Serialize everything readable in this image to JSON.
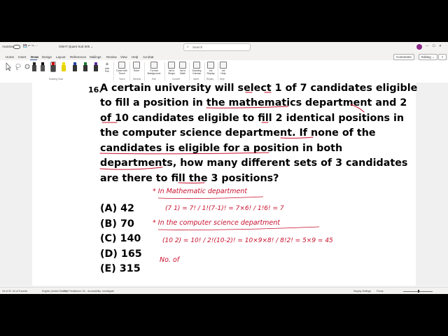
{
  "titlebar": {
    "autosave": "AutoSave",
    "doc_title": "GMAT Quant Sub 505 ⌄",
    "search_placeholder": "Search"
  },
  "tabs": [
    "Home",
    "Insert",
    "Draw",
    "Design",
    "Layout",
    "References",
    "Mailings",
    "Review",
    "View",
    "Help",
    "Acrobat"
  ],
  "active_tab": "Draw",
  "tab_actions": {
    "comments": "Comments",
    "editing": "Editing ⌄"
  },
  "ribbon": {
    "buttons": [
      {
        "label": "Draw with Touch"
      },
      {
        "label": "Ruler"
      },
      {
        "label": "Format Background"
      },
      {
        "label": "Ink to Shape"
      },
      {
        "label": "Ink to Math"
      },
      {
        "label": "Drawing Canvas"
      },
      {
        "label": "Ink Replay"
      },
      {
        "label": "Ink Help"
      }
    ],
    "add_pen_label": "Add Pen",
    "groups": {
      "drawing_tools": "Drawing Tools",
      "touch": "Touch",
      "stencils": "Stencils",
      "edit": "Edit",
      "convert": "Convert",
      "insert": "Insert",
      "replay": "Replay",
      "help": "Help"
    },
    "pen_colors": [
      "#d40000",
      "#f2e000",
      "#1a7a30",
      "#1f3f9f",
      "#222222"
    ]
  },
  "question": {
    "number": "16.",
    "lines": [
      "A certain university will select 1 of 7 candidates eligible",
      "to fill a position in the mathematics department and 2",
      "of 10 candidates eligible to fill 2 identical positions in",
      "the computer science department. If none of the",
      "candidates is eligible for a position in both",
      "departments, how many different sets of 3 candidates",
      "are there to fill the 3 positions?"
    ],
    "choices": [
      "(A) 42",
      "(B) 70",
      "(C) 140",
      "(D) 165",
      "(E) 315"
    ]
  },
  "ink_notes": {
    "note1": "* In Mathematic department",
    "calc1": "(7 1) = 7! / 1!(7-1)! = 7×6! / 1!6! = 7",
    "note2": "* In the computer science department",
    "calc2": "(10 2) = 10! / 2!(10-2)! = 10×9×8! / 8!2! = 5×9 = 45",
    "note3": "No. of"
  },
  "statusbar": {
    "page": "16 of 33",
    "words": "64 of 5 words",
    "language": "English (United States)",
    "text_predictions": "Text Predictions: On",
    "accessibility": "Accessibility: Investigate",
    "display_settings": "Display Settings",
    "focus": "Focus"
  }
}
